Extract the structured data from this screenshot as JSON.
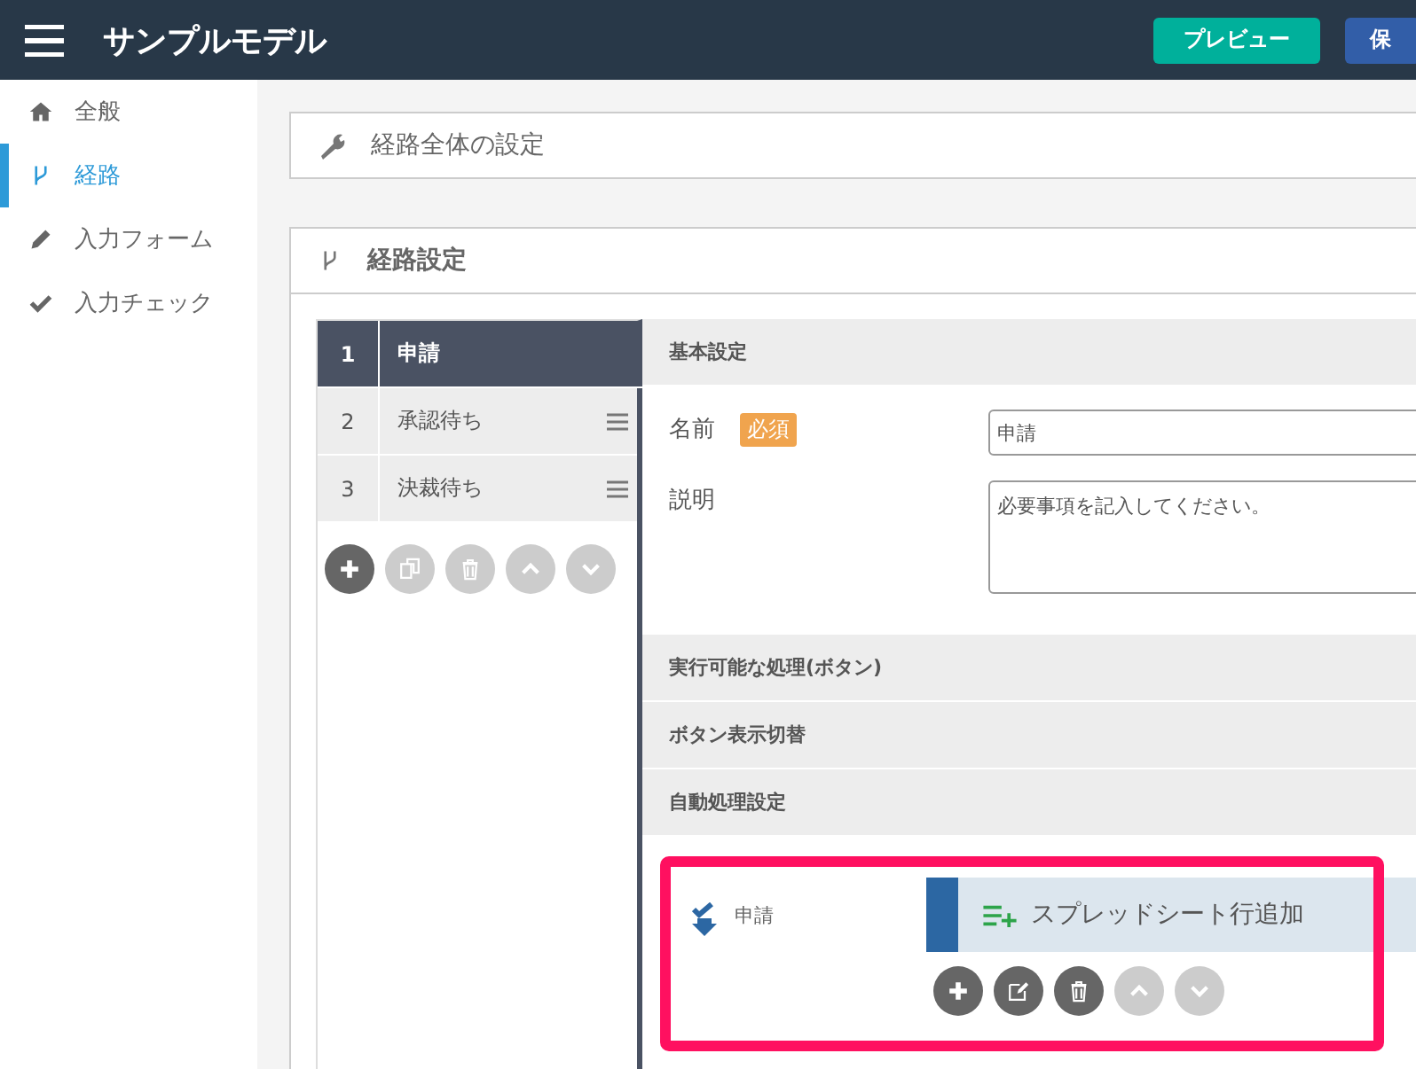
{
  "header": {
    "title": "サンプルモデル",
    "buttons": [
      {
        "label": "プレビュー",
        "kind": "preview"
      },
      {
        "label": "保",
        "kind": "save"
      }
    ]
  },
  "sidebar": {
    "items": [
      {
        "label": "全般",
        "selected": false
      },
      {
        "label": "経路",
        "selected": true
      },
      {
        "label": "入力フォーム",
        "selected": false
      },
      {
        "label": "入力チェック",
        "selected": false
      }
    ]
  },
  "global_panel": {
    "title": "経路全体の設定"
  },
  "route_panel": {
    "title": "経路設定",
    "steps": [
      {
        "number": "1",
        "name": "申請",
        "selected": true
      },
      {
        "number": "2",
        "name": "承認待ち",
        "selected": false
      },
      {
        "number": "3",
        "name": "決裁待ち",
        "selected": false
      }
    ],
    "step_actions": [
      {
        "kind": "add",
        "disabled": false
      },
      {
        "kind": "copy",
        "disabled": true
      },
      {
        "kind": "delete",
        "disabled": true
      },
      {
        "kind": "up",
        "disabled": true
      },
      {
        "kind": "down",
        "disabled": true
      }
    ],
    "basic": {
      "title": "基本設定",
      "name_label": "名前",
      "required_badge": "必須",
      "name_value": "申請",
      "description_label": "説明",
      "description_value": "必要事項を記入してください。"
    },
    "sections": [
      {
        "title": "実行可能な処理(ボタン)"
      },
      {
        "title": "ボタン表示切替"
      },
      {
        "title": "自動処理設定"
      }
    ],
    "automation": {
      "highlighted": true,
      "trigger": "申請",
      "action": "スプレッドシート行追加",
      "actions": [
        {
          "kind": "add",
          "disabled": false
        },
        {
          "kind": "edit",
          "disabled": false
        },
        {
          "kind": "delete",
          "disabled": false
        },
        {
          "kind": "up",
          "disabled": true
        },
        {
          "kind": "down",
          "disabled": true
        }
      ]
    }
  }
}
